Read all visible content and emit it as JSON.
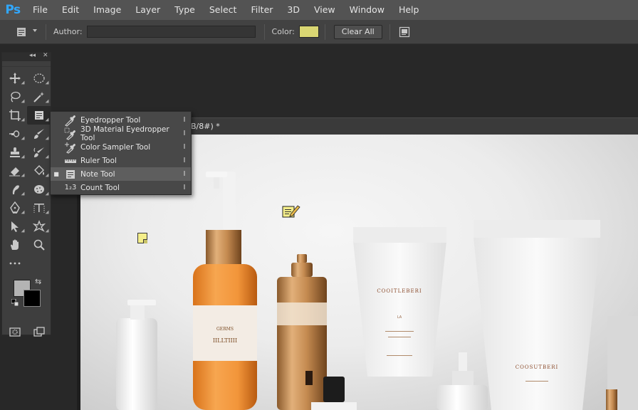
{
  "app": {
    "logo": "Ps"
  },
  "menu": [
    "File",
    "Edit",
    "Image",
    "Layer",
    "Type",
    "Select",
    "Filter",
    "3D",
    "View",
    "Window",
    "Help"
  ],
  "options": {
    "author_label": "Author:",
    "author_value": "",
    "color_label": "Color:",
    "note_color": "#d9d673",
    "clear_all_label": "Clear All"
  },
  "document": {
    "tab_title": "B/8#) *"
  },
  "toolbox": {
    "foreground_color": "#b4b4b4",
    "background_color": "#000000"
  },
  "flyout": {
    "items": [
      {
        "icon": "eyedropper-icon",
        "label": "Eyedropper Tool",
        "shortcut": "I",
        "selected": false
      },
      {
        "icon": "3d-eyedropper-icon",
        "label": "3D Material Eyedropper Tool",
        "shortcut": "I",
        "selected": false
      },
      {
        "icon": "color-sampler-icon",
        "label": "Color Sampler Tool",
        "shortcut": "I",
        "selected": false
      },
      {
        "icon": "ruler-icon",
        "label": "Ruler Tool",
        "shortcut": "I",
        "selected": false
      },
      {
        "icon": "note-icon",
        "label": "Note Tool",
        "shortcut": "I",
        "selected": true
      },
      {
        "icon": "count-icon",
        "label": "Count Tool",
        "shortcut": "I",
        "selected": false
      }
    ],
    "selected_bullet": "■",
    "count_icon_text": "1₂3"
  }
}
